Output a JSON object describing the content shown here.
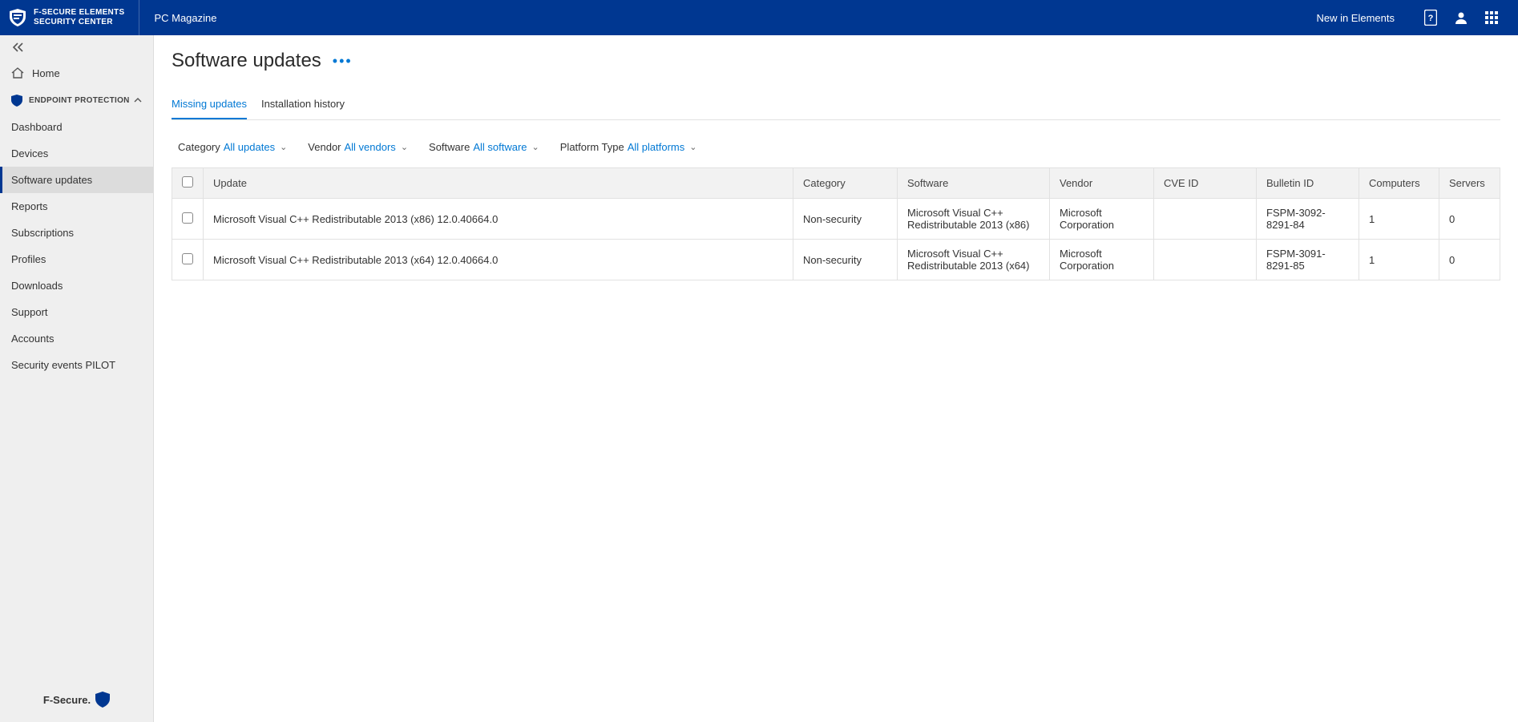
{
  "brand": {
    "line1": "F-SECURE ELEMENTS",
    "line2": "SECURITY CENTER"
  },
  "org": "PC Magazine",
  "topbar": {
    "new_link": "New in Elements"
  },
  "sidebar": {
    "home": "Home",
    "section": "ENDPOINT PROTECTION",
    "items": [
      {
        "label": "Dashboard"
      },
      {
        "label": "Devices"
      },
      {
        "label": "Software updates"
      },
      {
        "label": "Reports"
      },
      {
        "label": "Subscriptions"
      },
      {
        "label": "Profiles"
      },
      {
        "label": "Downloads"
      },
      {
        "label": "Support"
      },
      {
        "label": "Accounts"
      },
      {
        "label": "Security events PILOT"
      }
    ],
    "footer": "F-Secure."
  },
  "page": {
    "title": "Software updates"
  },
  "tabs": [
    {
      "label": "Missing updates",
      "active": true
    },
    {
      "label": "Installation history",
      "active": false
    }
  ],
  "filters": {
    "category": {
      "label": "Category",
      "value": "All updates"
    },
    "vendor": {
      "label": "Vendor",
      "value": "All vendors"
    },
    "software": {
      "label": "Software",
      "value": "All software"
    },
    "platform": {
      "label": "Platform Type",
      "value": "All platforms"
    }
  },
  "table": {
    "headers": {
      "update": "Update",
      "category": "Category",
      "software": "Software",
      "vendor": "Vendor",
      "cve": "CVE ID",
      "bulletin": "Bulletin ID",
      "computers": "Computers",
      "servers": "Servers"
    },
    "rows": [
      {
        "update": "Microsoft Visual C++ Redistributable 2013 (x86) 12.0.40664.0",
        "category": "Non-security",
        "software": "Microsoft Visual C++ Redistributable 2013 (x86)",
        "vendor": "Microsoft Corporation",
        "cve": "",
        "bulletin": "FSPM-3092-8291-84",
        "computers": "1",
        "servers": "0"
      },
      {
        "update": "Microsoft Visual C++ Redistributable 2013 (x64) 12.0.40664.0",
        "category": "Non-security",
        "software": "Microsoft Visual C++ Redistributable 2013 (x64)",
        "vendor": "Microsoft Corporation",
        "cve": "",
        "bulletin": "FSPM-3091-8291-85",
        "computers": "1",
        "servers": "0"
      }
    ]
  }
}
